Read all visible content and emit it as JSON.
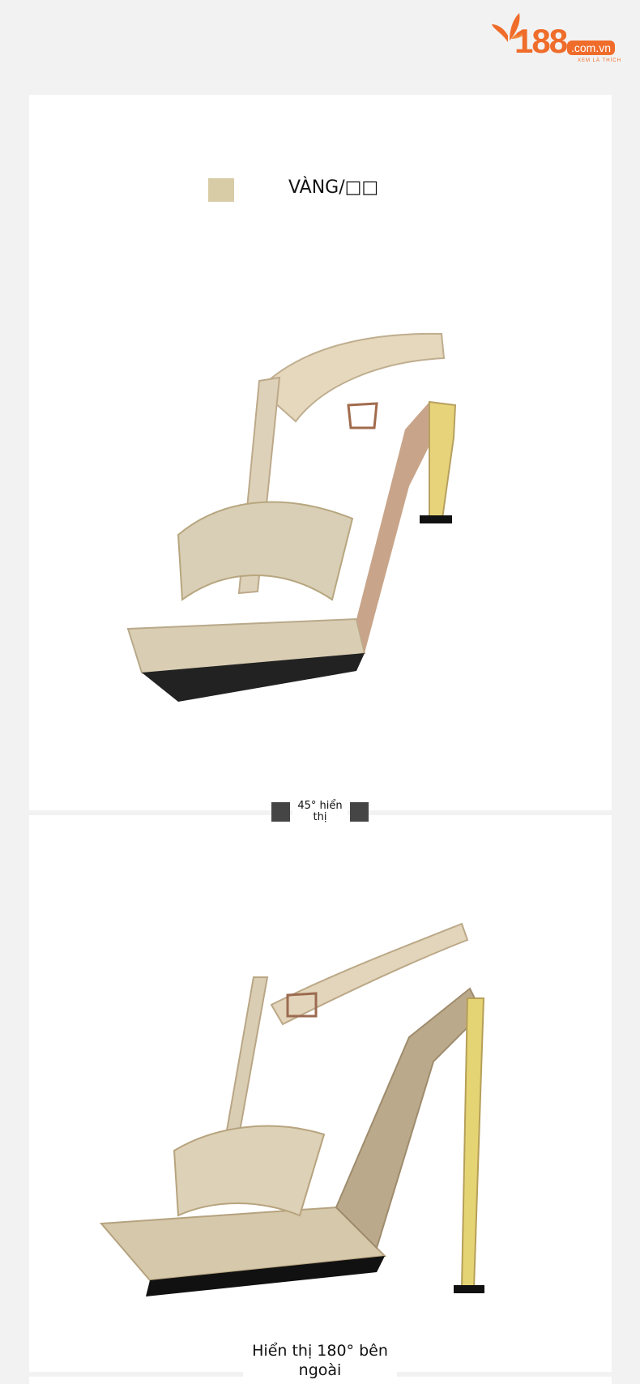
{
  "header": {
    "logo": {
      "number": "188",
      "domain": ".com.vn",
      "tagline": "XEM LÀ THÍCH"
    }
  },
  "colors": {
    "brand": "#ef6c2a",
    "swatch_gold": "#d8cca7",
    "background": "#f2f2f2"
  },
  "color_option": {
    "label": "VÀNG/□□"
  },
  "views": {
    "angle_45_label": "45° hiển thị",
    "outside_180_label": "Hiển thị 180° bên ngoài"
  }
}
